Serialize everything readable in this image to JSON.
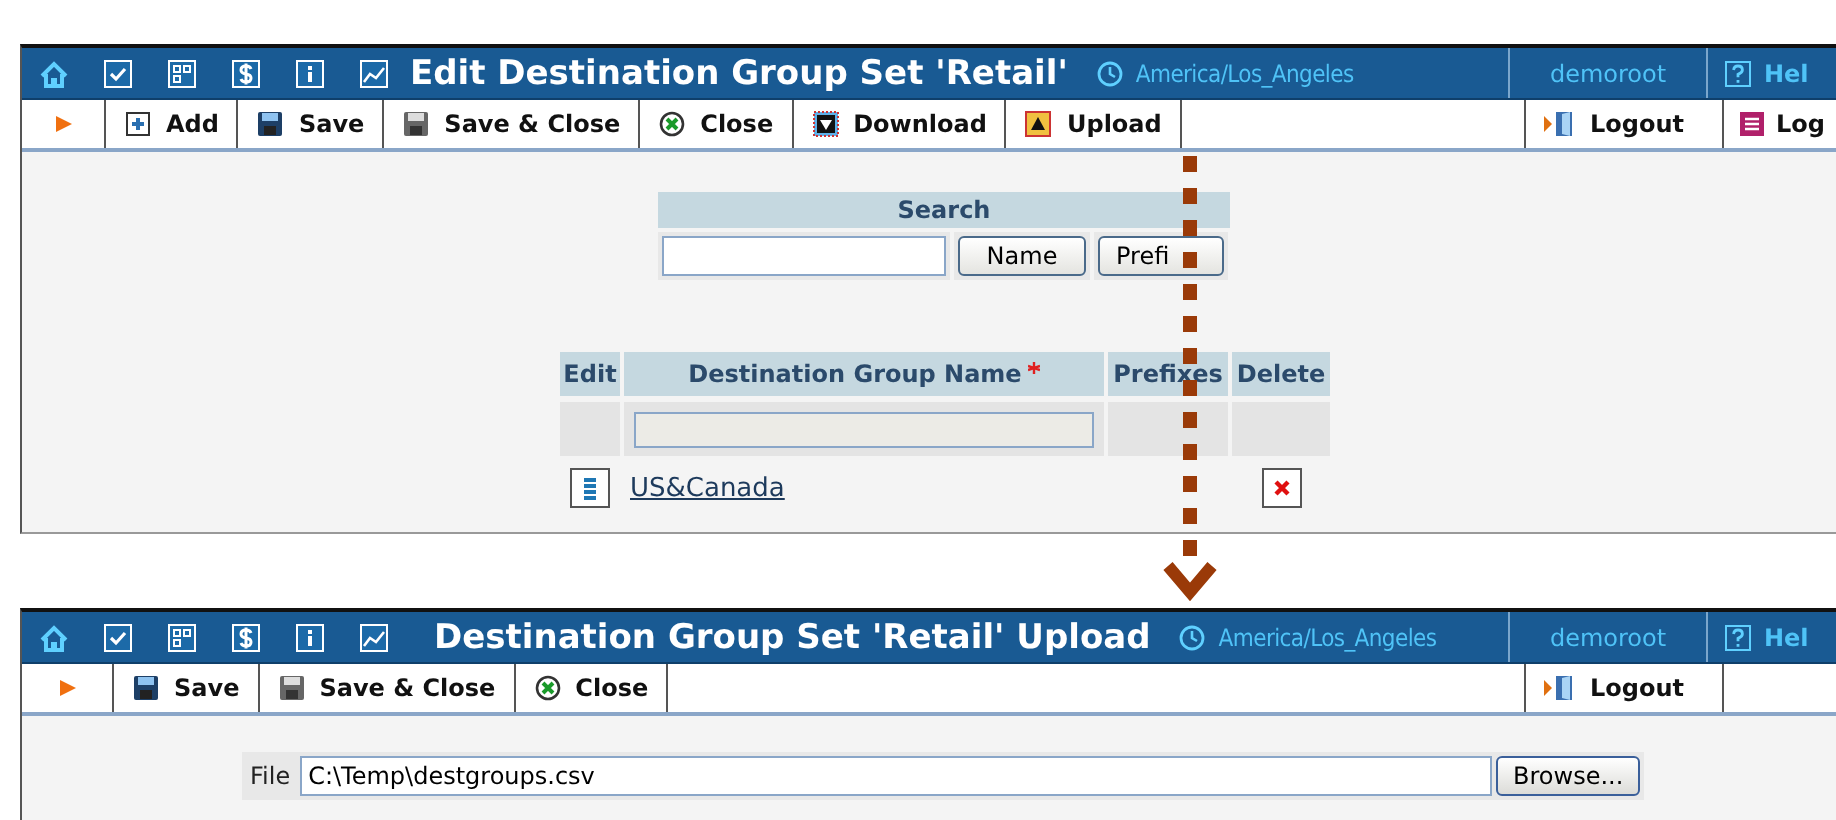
{
  "edit_window": {
    "title": "Edit Destination Group Set 'Retail'",
    "timezone": "America/Los_Angeles",
    "user": "demoroot",
    "help": "Hel",
    "toolbar": [
      {
        "kind": "add",
        "label": "Add"
      },
      {
        "kind": "save",
        "label": "Save"
      },
      {
        "kind": "save_close",
        "label": "Save & Close"
      },
      {
        "kind": "close",
        "label": "Close"
      },
      {
        "kind": "download",
        "label": "Download"
      },
      {
        "kind": "upload",
        "label": "Upload"
      }
    ],
    "logout": "Logout",
    "log": "Log",
    "search": {
      "title": "Search",
      "buttons": [
        "Name",
        "Prefi"
      ]
    },
    "table": {
      "columns": [
        "Edit",
        "Destination Group Name",
        "Prefixes",
        "Delete"
      ],
      "rows": [
        {
          "name": "US&Canada"
        }
      ]
    }
  },
  "upload_window": {
    "title": "Destination Group Set 'Retail' Upload",
    "timezone": "America/Los_Angeles",
    "user": "demoroot",
    "help": "Hel",
    "toolbar": [
      {
        "kind": "save",
        "label": "Save"
      },
      {
        "kind": "save_close",
        "label": "Save & Close"
      },
      {
        "kind": "close",
        "label": "Close"
      }
    ],
    "logout": "Logout",
    "file": {
      "label": "File",
      "value": "C:\\Temp\\destgroups.csv",
      "button": "Browse..."
    }
  }
}
